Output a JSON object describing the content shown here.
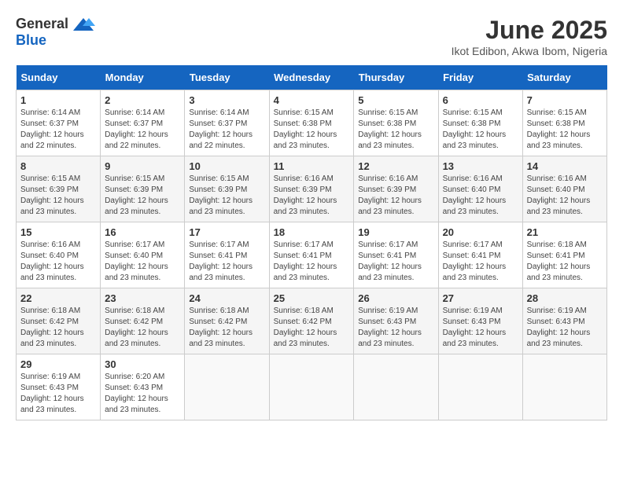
{
  "logo": {
    "general": "General",
    "blue": "Blue"
  },
  "title": {
    "month": "June 2025",
    "location": "Ikot Edibon, Akwa Ibom, Nigeria"
  },
  "headers": [
    "Sunday",
    "Monday",
    "Tuesday",
    "Wednesday",
    "Thursday",
    "Friday",
    "Saturday"
  ],
  "weeks": [
    [
      {
        "day": "1",
        "sunrise": "6:14 AM",
        "sunset": "6:37 PM",
        "daylight": "12 hours and 22 minutes."
      },
      {
        "day": "2",
        "sunrise": "6:14 AM",
        "sunset": "6:37 PM",
        "daylight": "12 hours and 22 minutes."
      },
      {
        "day": "3",
        "sunrise": "6:14 AM",
        "sunset": "6:37 PM",
        "daylight": "12 hours and 22 minutes."
      },
      {
        "day": "4",
        "sunrise": "6:15 AM",
        "sunset": "6:38 PM",
        "daylight": "12 hours and 23 minutes."
      },
      {
        "day": "5",
        "sunrise": "6:15 AM",
        "sunset": "6:38 PM",
        "daylight": "12 hours and 23 minutes."
      },
      {
        "day": "6",
        "sunrise": "6:15 AM",
        "sunset": "6:38 PM",
        "daylight": "12 hours and 23 minutes."
      },
      {
        "day": "7",
        "sunrise": "6:15 AM",
        "sunset": "6:38 PM",
        "daylight": "12 hours and 23 minutes."
      }
    ],
    [
      {
        "day": "8",
        "sunrise": "6:15 AM",
        "sunset": "6:39 PM",
        "daylight": "12 hours and 23 minutes."
      },
      {
        "day": "9",
        "sunrise": "6:15 AM",
        "sunset": "6:39 PM",
        "daylight": "12 hours and 23 minutes."
      },
      {
        "day": "10",
        "sunrise": "6:15 AM",
        "sunset": "6:39 PM",
        "daylight": "12 hours and 23 minutes."
      },
      {
        "day": "11",
        "sunrise": "6:16 AM",
        "sunset": "6:39 PM",
        "daylight": "12 hours and 23 minutes."
      },
      {
        "day": "12",
        "sunrise": "6:16 AM",
        "sunset": "6:39 PM",
        "daylight": "12 hours and 23 minutes."
      },
      {
        "day": "13",
        "sunrise": "6:16 AM",
        "sunset": "6:40 PM",
        "daylight": "12 hours and 23 minutes."
      },
      {
        "day": "14",
        "sunrise": "6:16 AM",
        "sunset": "6:40 PM",
        "daylight": "12 hours and 23 minutes."
      }
    ],
    [
      {
        "day": "15",
        "sunrise": "6:16 AM",
        "sunset": "6:40 PM",
        "daylight": "12 hours and 23 minutes."
      },
      {
        "day": "16",
        "sunrise": "6:17 AM",
        "sunset": "6:40 PM",
        "daylight": "12 hours and 23 minutes."
      },
      {
        "day": "17",
        "sunrise": "6:17 AM",
        "sunset": "6:41 PM",
        "daylight": "12 hours and 23 minutes."
      },
      {
        "day": "18",
        "sunrise": "6:17 AM",
        "sunset": "6:41 PM",
        "daylight": "12 hours and 23 minutes."
      },
      {
        "day": "19",
        "sunrise": "6:17 AM",
        "sunset": "6:41 PM",
        "daylight": "12 hours and 23 minutes."
      },
      {
        "day": "20",
        "sunrise": "6:17 AM",
        "sunset": "6:41 PM",
        "daylight": "12 hours and 23 minutes."
      },
      {
        "day": "21",
        "sunrise": "6:18 AM",
        "sunset": "6:41 PM",
        "daylight": "12 hours and 23 minutes."
      }
    ],
    [
      {
        "day": "22",
        "sunrise": "6:18 AM",
        "sunset": "6:42 PM",
        "daylight": "12 hours and 23 minutes."
      },
      {
        "day": "23",
        "sunrise": "6:18 AM",
        "sunset": "6:42 PM",
        "daylight": "12 hours and 23 minutes."
      },
      {
        "day": "24",
        "sunrise": "6:18 AM",
        "sunset": "6:42 PM",
        "daylight": "12 hours and 23 minutes."
      },
      {
        "day": "25",
        "sunrise": "6:18 AM",
        "sunset": "6:42 PM",
        "daylight": "12 hours and 23 minutes."
      },
      {
        "day": "26",
        "sunrise": "6:19 AM",
        "sunset": "6:43 PM",
        "daylight": "12 hours and 23 minutes."
      },
      {
        "day": "27",
        "sunrise": "6:19 AM",
        "sunset": "6:43 PM",
        "daylight": "12 hours and 23 minutes."
      },
      {
        "day": "28",
        "sunrise": "6:19 AM",
        "sunset": "6:43 PM",
        "daylight": "12 hours and 23 minutes."
      }
    ],
    [
      {
        "day": "29",
        "sunrise": "6:19 AM",
        "sunset": "6:43 PM",
        "daylight": "12 hours and 23 minutes."
      },
      {
        "day": "30",
        "sunrise": "6:20 AM",
        "sunset": "6:43 PM",
        "daylight": "12 hours and 23 minutes."
      },
      null,
      null,
      null,
      null,
      null
    ]
  ],
  "labels": {
    "sunrise": "Sunrise: ",
    "sunset": "Sunset: ",
    "daylight": "Daylight: "
  }
}
